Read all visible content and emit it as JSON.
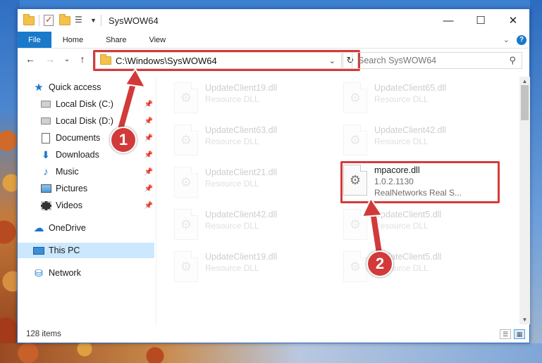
{
  "window": {
    "title": "SysWOW64",
    "controls": {
      "minimize": "—",
      "maximize": "☐",
      "close": "✕"
    }
  },
  "ribbon": {
    "tabs": [
      "File",
      "Home",
      "Share",
      "View"
    ],
    "help": "?"
  },
  "address": {
    "path": "C:\\Windows\\SysWOW64",
    "search_placeholder": "Search SysWOW64"
  },
  "nav": {
    "items": [
      {
        "label": "Quick access",
        "icon": "star-icon",
        "pinned": false
      },
      {
        "label": "Local Disk (C:)",
        "icon": "drive-icon",
        "pinned": true
      },
      {
        "label": "Local Disk (D:)",
        "icon": "drive-icon",
        "pinned": true
      },
      {
        "label": "Documents",
        "icon": "documents-icon",
        "pinned": true
      },
      {
        "label": "Downloads",
        "icon": "downloads-icon",
        "pinned": true
      },
      {
        "label": "Music",
        "icon": "music-icon",
        "pinned": true
      },
      {
        "label": "Pictures",
        "icon": "pictures-icon",
        "pinned": true
      },
      {
        "label": "Videos",
        "icon": "videos-icon",
        "pinned": true
      },
      {
        "label": "OneDrive",
        "icon": "onedrive-icon",
        "pinned": false
      },
      {
        "label": "This PC",
        "icon": "this-pc-icon",
        "pinned": false
      },
      {
        "label": "Network",
        "icon": "network-icon",
        "pinned": false
      }
    ]
  },
  "files": [
    {
      "name": "UpdateClient19.dll",
      "type": "Resource DLL"
    },
    {
      "name": "UpdateClient65.dll",
      "type": "Resource DLL"
    },
    {
      "name": "UpdateClient63.dll",
      "type": "Resource DLL"
    },
    {
      "name": "UpdateClient42.dll",
      "type": "Resource DLL"
    },
    {
      "name": "UpdateClient21.dll",
      "type": "Resource DLL"
    },
    {
      "name": "UpdateClient42.dll",
      "type": "Resource DLL"
    },
    {
      "name": "UpdateClient5.dll",
      "type": "Resource DLL"
    },
    {
      "name": "UpdateClient19.dll",
      "type": "Resource DLL"
    },
    {
      "name": "UpdateClient5.dll",
      "type": "Resource DLL"
    }
  ],
  "selected_file": {
    "name": "mpacore.dll",
    "version": "1.0.2.1130",
    "company": "RealNetworks Real S..."
  },
  "status": {
    "item_count": "128 items"
  },
  "markers": [
    "1",
    "2"
  ],
  "colors": {
    "accent": "#1979ca",
    "highlight": "#d63a3a",
    "selected_nav": "#cce8ff"
  }
}
